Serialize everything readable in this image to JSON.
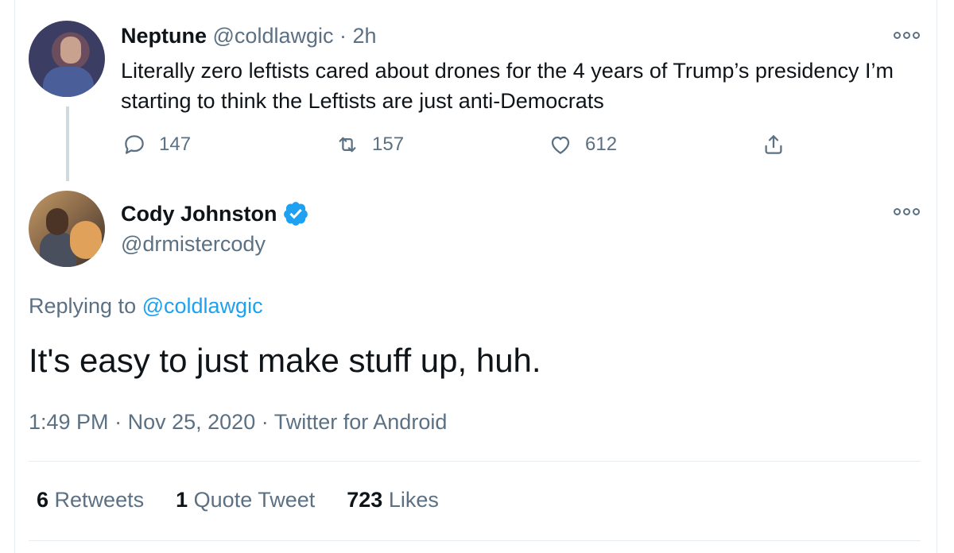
{
  "parent_tweet": {
    "author_name": "Neptune",
    "author_handle": "@coldlawgic",
    "separator": "·",
    "time": "2h",
    "text": "Literally zero leftists cared about drones for the 4 years of Trump’s presidency I’m starting to think the Leftists are just anti-Democrats",
    "actions": {
      "reply_icon": "reply-icon",
      "reply_count": "147",
      "retweet_icon": "retweet-icon",
      "retweet_count": "157",
      "like_icon": "like-icon",
      "like_count": "612",
      "share_icon": "share-icon"
    }
  },
  "main_tweet": {
    "author_name": "Cody Johnston",
    "author_handle": "@drmistercody",
    "verified_icon": "verified-badge-icon",
    "replying_prefix": "Replying to",
    "replying_handle": "@coldlawgic",
    "text": "It's easy to just make stuff up, huh.",
    "time": "1:49 PM",
    "separator": "·",
    "date": "Nov 25, 2020",
    "source": "Twitter for Android"
  },
  "stats": {
    "retweets_count": "6",
    "retweets_label": "Retweets",
    "quotes_count": "1",
    "quotes_label": "Quote Tweet",
    "likes_count": "723",
    "likes_label": "Likes"
  },
  "colors": {
    "link": "#1da1f2",
    "muted": "#5b7083",
    "text": "#0f1419",
    "divider": "#e6ecf0"
  }
}
